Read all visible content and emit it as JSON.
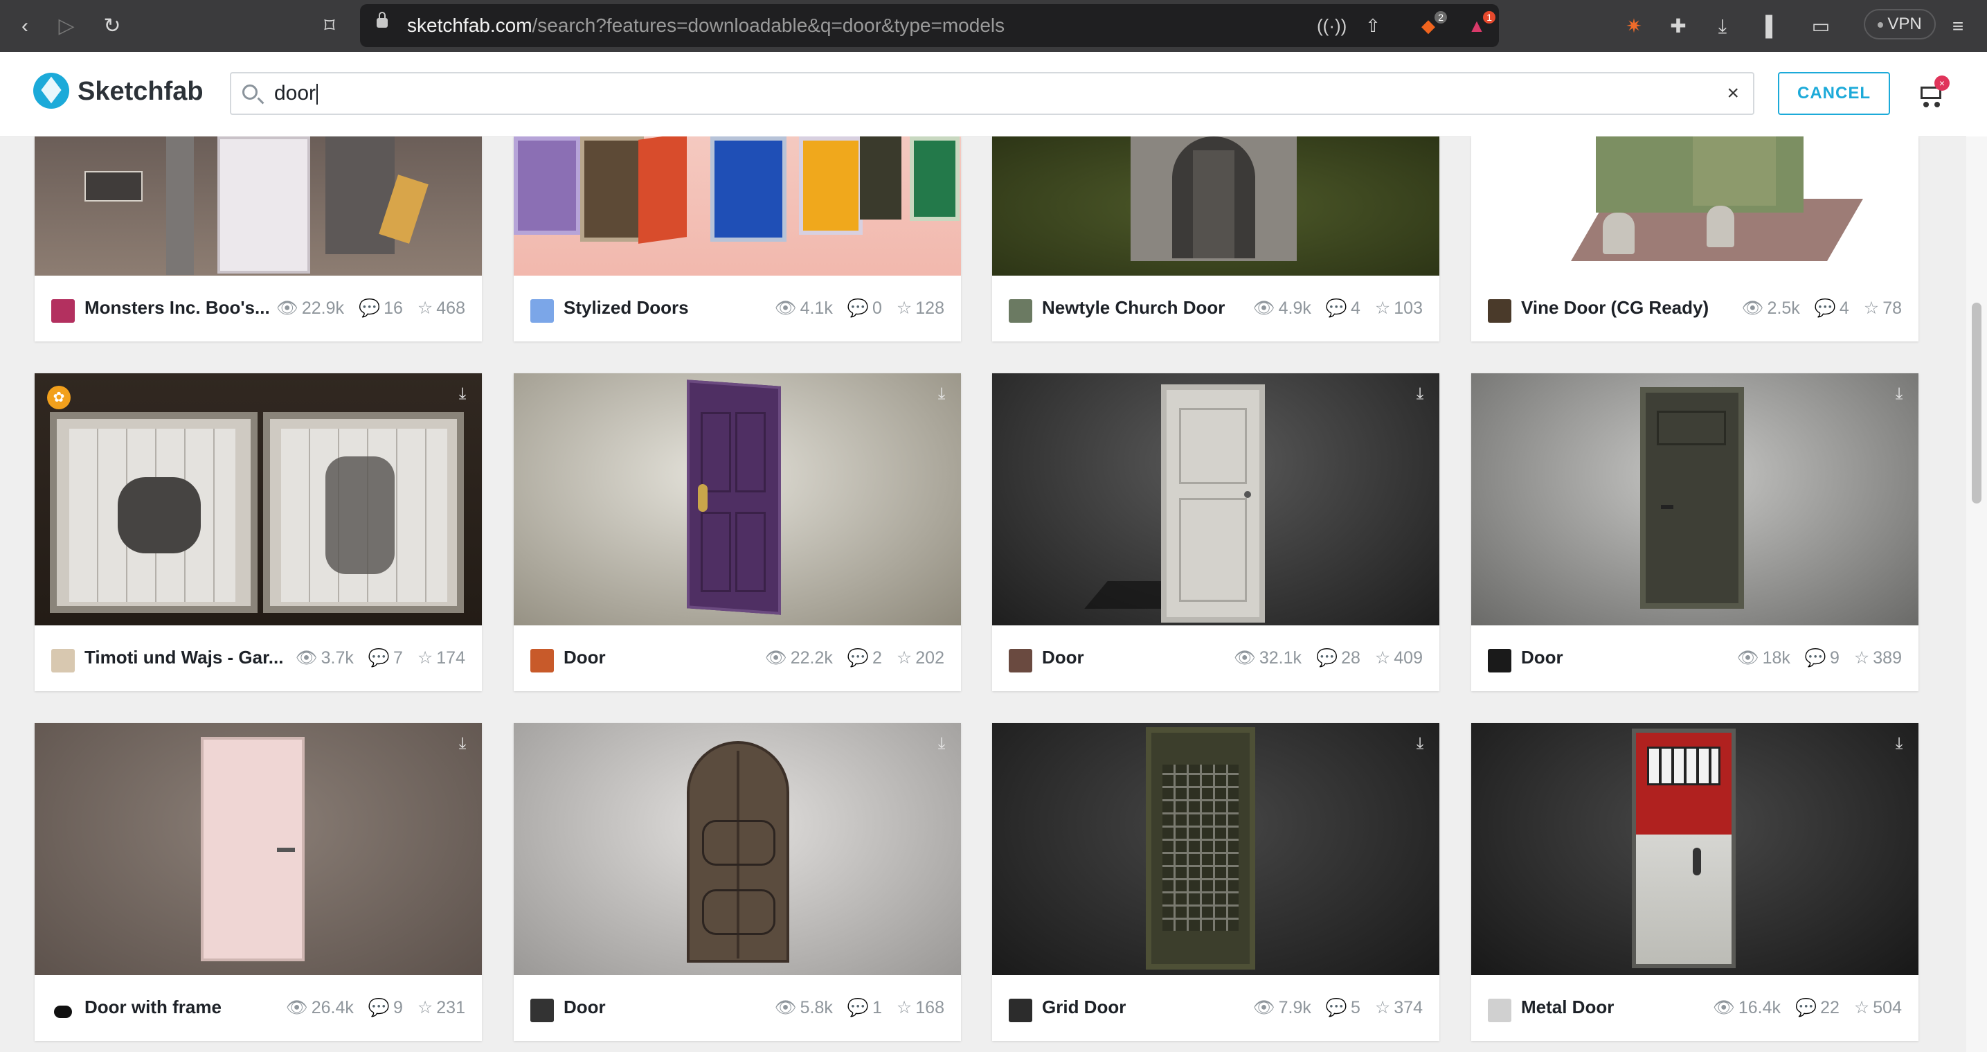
{
  "browser": {
    "url_host": "sketchfab.com",
    "url_path": "/search?features=downloadable&q=door&type=models",
    "brave_shield_count": "2",
    "alert_count": "1",
    "vpn_label": "VPN"
  },
  "header": {
    "brand": "Sketchfab",
    "search_value": "door",
    "clear_label": "×",
    "cancel_label": "CANCEL",
    "cart_badge": "×"
  },
  "models": [
    {
      "title": "Monsters Inc. Boo's...",
      "views": "22.9k",
      "comments": "16",
      "likes": "468"
    },
    {
      "title": "Stylized Doors",
      "views": "4.1k",
      "comments": "0",
      "likes": "128"
    },
    {
      "title": "Newtyle Church Door",
      "views": "4.9k",
      "comments": "4",
      "likes": "103"
    },
    {
      "title": "Vine Door (CG Ready)",
      "views": "2.5k",
      "comments": "4",
      "likes": "78"
    },
    {
      "title": "Timoti und Wajs - Gar...",
      "views": "3.7k",
      "comments": "7",
      "likes": "174"
    },
    {
      "title": "Door",
      "views": "22.2k",
      "comments": "2",
      "likes": "202"
    },
    {
      "title": "Door",
      "views": "32.1k",
      "comments": "28",
      "likes": "409"
    },
    {
      "title": "Door",
      "views": "18k",
      "comments": "9",
      "likes": "389"
    },
    {
      "title": "Door with frame",
      "views": "26.4k",
      "comments": "9",
      "likes": "231"
    },
    {
      "title": "Door",
      "views": "5.8k",
      "comments": "1",
      "likes": "168"
    },
    {
      "title": "Grid Door",
      "views": "7.9k",
      "comments": "5",
      "likes": "374"
    },
    {
      "title": "Metal Door",
      "views": "16.4k",
      "comments": "22",
      "likes": "504"
    }
  ],
  "icons": {
    "views": "eye-icon",
    "comments": "comment-icon",
    "likes": "star-icon",
    "download": "download-icon"
  }
}
